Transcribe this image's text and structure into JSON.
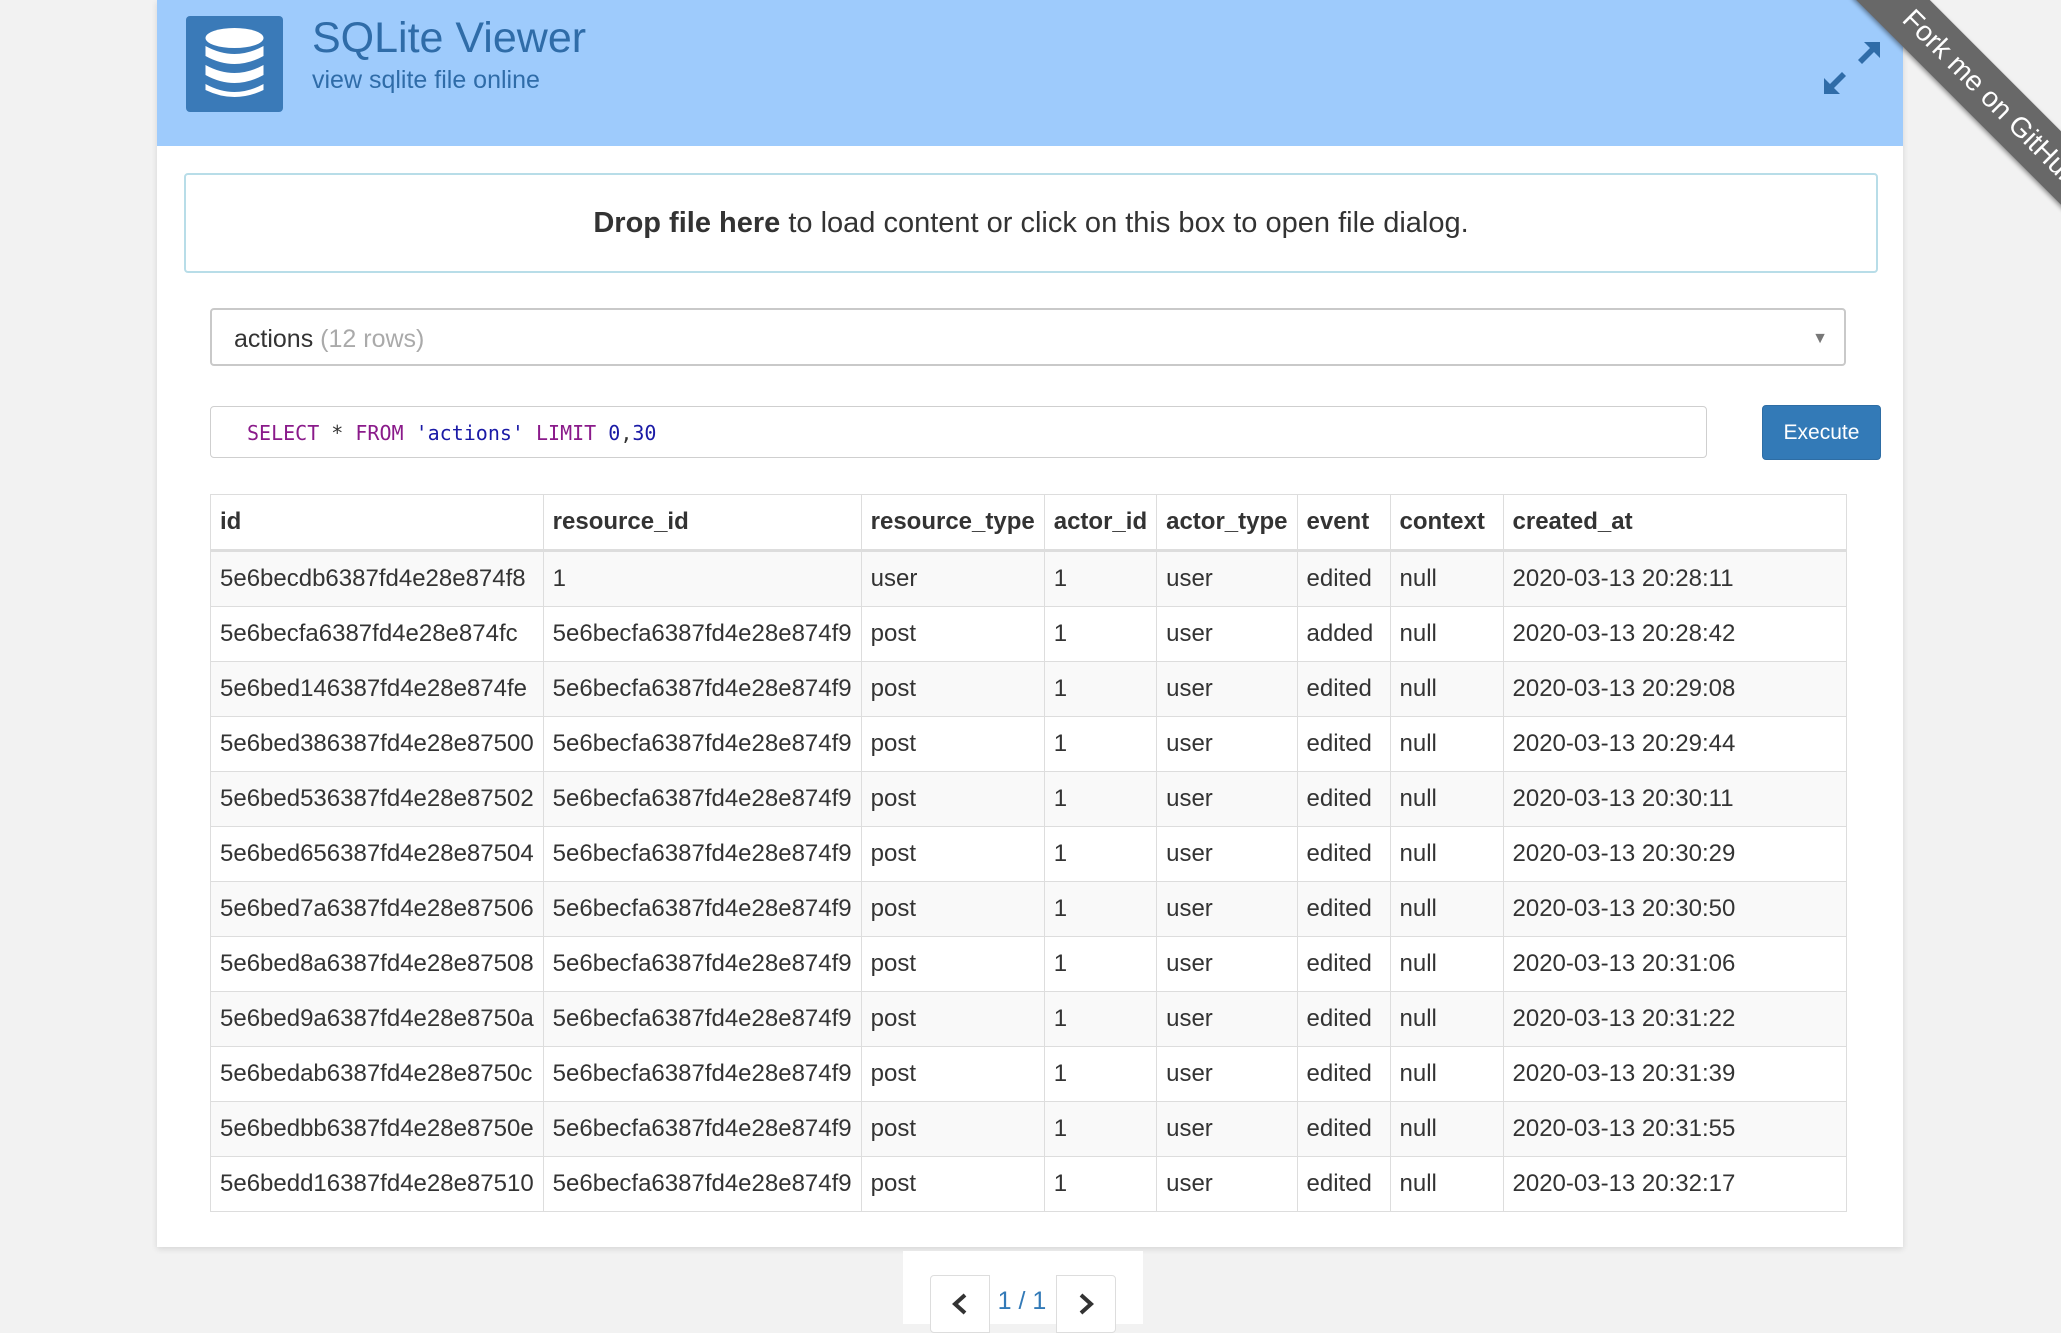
{
  "header": {
    "title": "SQLite Viewer",
    "subtitle": "view sqlite file online",
    "colors": {
      "background": "#9ecbfc",
      "logo": "#3a7ab8",
      "text": "#2f6ca8"
    }
  },
  "ribbon": {
    "label": "Fork me on GitHub"
  },
  "dropzone": {
    "bold": "Drop file here",
    "rest": " to load content or click on this box to open file dialog."
  },
  "table_select": {
    "name": "actions",
    "count": "(12 rows)"
  },
  "query": {
    "kw1": "SELECT",
    "star": " * ",
    "kw2": "FROM",
    "table": "'actions'",
    "kw3": "LIMIT",
    "n1": "0",
    "comma": ",",
    "n2": "30"
  },
  "execute_label": "Execute",
  "columns": [
    "id",
    "resource_id",
    "resource_type",
    "actor_id",
    "actor_type",
    "event",
    "context",
    "created_at"
  ],
  "rows": [
    [
      "5e6becdb6387fd4e28e874f8",
      "1",
      "user",
      "1",
      "user",
      "edited",
      "null",
      "2020-03-13 20:28:11"
    ],
    [
      "5e6becfa6387fd4e28e874fc",
      "5e6becfa6387fd4e28e874f9",
      "post",
      "1",
      "user",
      "added",
      "null",
      "2020-03-13 20:28:42"
    ],
    [
      "5e6bed146387fd4e28e874fe",
      "5e6becfa6387fd4e28e874f9",
      "post",
      "1",
      "user",
      "edited",
      "null",
      "2020-03-13 20:29:08"
    ],
    [
      "5e6bed386387fd4e28e87500",
      "5e6becfa6387fd4e28e874f9",
      "post",
      "1",
      "user",
      "edited",
      "null",
      "2020-03-13 20:29:44"
    ],
    [
      "5e6bed536387fd4e28e87502",
      "5e6becfa6387fd4e28e874f9",
      "post",
      "1",
      "user",
      "edited",
      "null",
      "2020-03-13 20:30:11"
    ],
    [
      "5e6bed656387fd4e28e87504",
      "5e6becfa6387fd4e28e874f9",
      "post",
      "1",
      "user",
      "edited",
      "null",
      "2020-03-13 20:30:29"
    ],
    [
      "5e6bed7a6387fd4e28e87506",
      "5e6becfa6387fd4e28e874f9",
      "post",
      "1",
      "user",
      "edited",
      "null",
      "2020-03-13 20:30:50"
    ],
    [
      "5e6bed8a6387fd4e28e87508",
      "5e6becfa6387fd4e28e874f9",
      "post",
      "1",
      "user",
      "edited",
      "null",
      "2020-03-13 20:31:06"
    ],
    [
      "5e6bed9a6387fd4e28e8750a",
      "5e6becfa6387fd4e28e874f9",
      "post",
      "1",
      "user",
      "edited",
      "null",
      "2020-03-13 20:31:22"
    ],
    [
      "5e6bedab6387fd4e28e8750c",
      "5e6becfa6387fd4e28e874f9",
      "post",
      "1",
      "user",
      "edited",
      "null",
      "2020-03-13 20:31:39"
    ],
    [
      "5e6bedbb6387fd4e28e8750e",
      "5e6becfa6387fd4e28e874f9",
      "post",
      "1",
      "user",
      "edited",
      "null",
      "2020-03-13 20:31:55"
    ],
    [
      "5e6bedd16387fd4e28e87510",
      "5e6becfa6387fd4e28e874f9",
      "post",
      "1",
      "user",
      "edited",
      "null",
      "2020-03-13 20:32:17"
    ]
  ],
  "pager": {
    "label": "1 / 1"
  },
  "icons": {
    "logo": "database-icon",
    "expand": "expand-icon",
    "prev": "chevron-left-icon",
    "next": "chevron-right-icon"
  },
  "colors": {
    "button": "#337ab7",
    "ribbon": "#686868",
    "page_bg": "#f2f2f2"
  }
}
